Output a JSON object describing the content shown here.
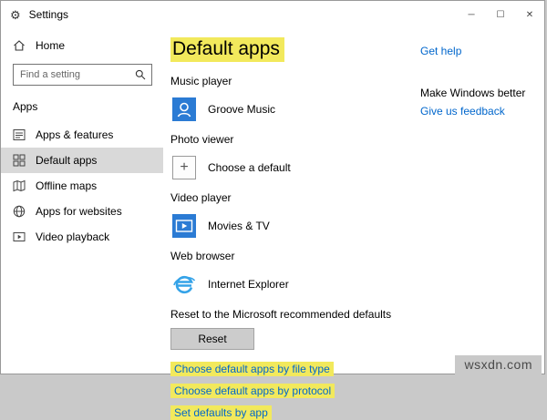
{
  "colors": {
    "accent": "#0078d7",
    "link": "#0066cc",
    "highlight": "#f2e95c"
  },
  "window": {
    "title": "Settings",
    "gear_icon": "⚙",
    "minimize_icon": "─",
    "maximize_icon": "☐",
    "close_icon": "✕"
  },
  "sidebar": {
    "home_label": "Home",
    "search_placeholder": "Find a setting",
    "section_label": "Apps",
    "items": [
      {
        "label": "Apps & features"
      },
      {
        "label": "Default apps"
      },
      {
        "label": "Offline maps"
      },
      {
        "label": "Apps for websites"
      },
      {
        "label": "Video playback"
      }
    ]
  },
  "main": {
    "title": "Default apps",
    "categories": [
      {
        "label": "Music player",
        "app": "Groove Music"
      },
      {
        "label": "Photo viewer",
        "app": "Choose a default"
      },
      {
        "label": "Video player",
        "app": "Movies & TV"
      },
      {
        "label": "Web browser",
        "app": "Internet Explorer"
      }
    ],
    "reset_description": "Reset to the Microsoft recommended defaults",
    "reset_button": "Reset",
    "links": [
      "Choose default apps by file type",
      "Choose default apps by protocol",
      "Set defaults by app"
    ]
  },
  "help": {
    "get_help": "Get help",
    "make_windows_better": "Make Windows better",
    "give_feedback": "Give us feedback"
  },
  "watermark": "wsxdn.com"
}
